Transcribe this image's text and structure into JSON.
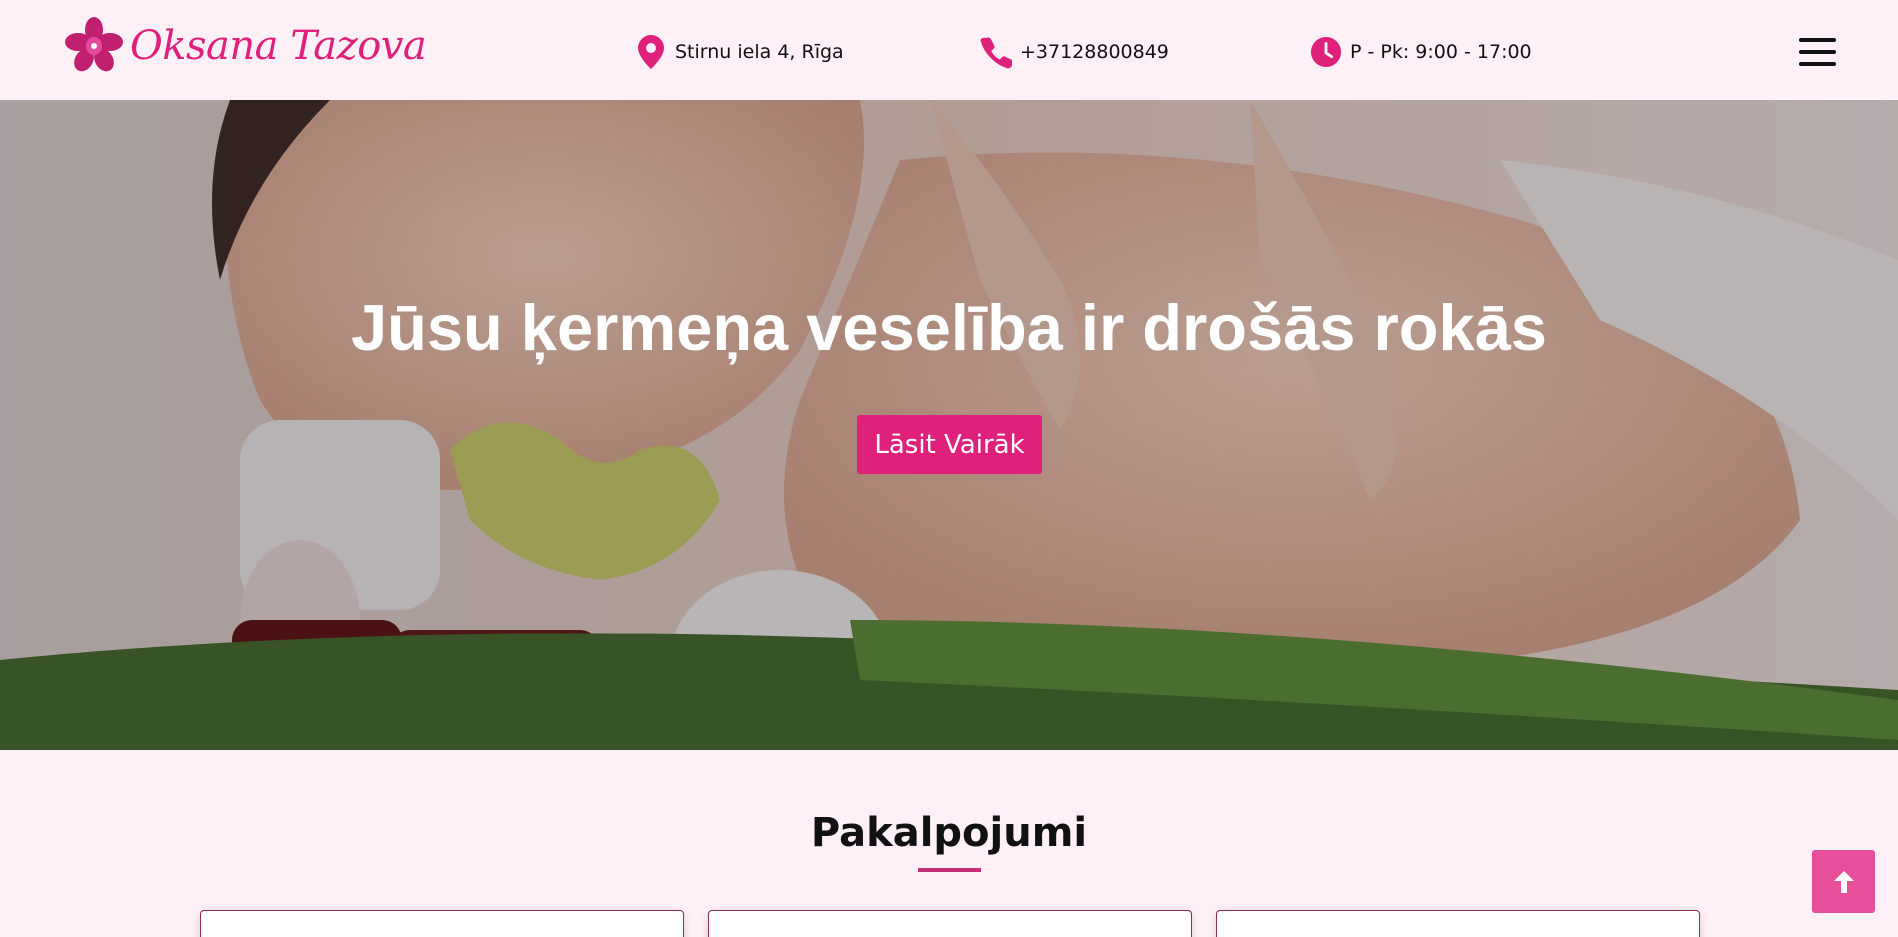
{
  "brand": {
    "name": "Oksana Tazova",
    "logo_icon": "orchid-flower-icon",
    "color": "#e0217c"
  },
  "header": {
    "address": {
      "icon": "map-pin-icon",
      "text": "Stirnu iela 4, Rīga"
    },
    "phone": {
      "icon": "phone-icon",
      "text": "+37128800849"
    },
    "hours": {
      "icon": "clock-icon",
      "text": "P - Pk: 9:00 - 17:00"
    },
    "menu_icon": "hamburger-menu-icon"
  },
  "hero": {
    "title": "Jūsu ķermeņa veselība ir drošās rokās",
    "button_label": "Lāsit Vairāk"
  },
  "services": {
    "title": "Pakalpojumi",
    "cards": [
      {},
      {},
      {}
    ]
  },
  "scroll_top": {
    "icon": "arrow-up-icon",
    "color": "#e84f9b"
  }
}
